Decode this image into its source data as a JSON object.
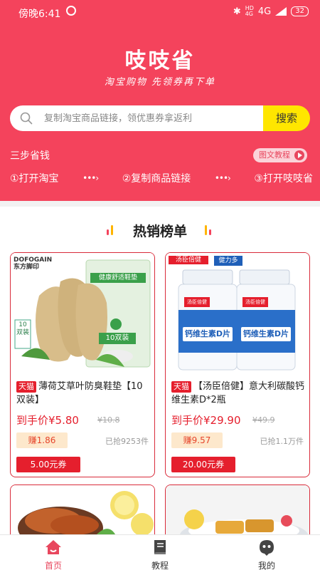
{
  "status_bar": {
    "time": "傍晚6:41",
    "network_top": "HD",
    "network_bottom": "4G",
    "network": "4G",
    "battery": "32"
  },
  "brand": {
    "title": "吱吱省",
    "subtitle": "淘宝购物 先领券再下单"
  },
  "search": {
    "placeholder": "复制淘宝商品链接，领优惠券拿返利",
    "button": "搜索"
  },
  "steps": {
    "title": "三步省钱",
    "tutorial": "图文教程",
    "items": [
      "①打开淘宝",
      "②复制商品链接",
      "③打开吱吱省"
    ],
    "arrow": "•••›"
  },
  "hot_list": {
    "title": "热销榜单",
    "products": [
      {
        "platform": "天猫",
        "name": "薄荷艾草叶防臭鞋垫【10双装】",
        "price": "到手价¥5.80",
        "old_price": "¥10.8",
        "earn": "赚1.86",
        "sold": "已抢9253件",
        "coupon": "5.00元券",
        "brand_text": "DOFOGAIN 东方脚印",
        "package_label": "健康舒适鞋垫",
        "badge": "10双装"
      },
      {
        "platform": "天猫",
        "name": "【汤臣倍健】意大利碳酸钙维生素D*2瓶",
        "price": "到手价¥29.90",
        "old_price": "¥49.9",
        "earn": "赚9.57",
        "sold": "已抢1.1万件",
        "coupon": "20.00元券",
        "brand_text": "汤臣倍健",
        "brand_text2": "健力多",
        "bottle_label": "钙维生素D片"
      }
    ]
  },
  "tabbar": [
    {
      "label": "首页",
      "icon": "home-icon",
      "active": true
    },
    {
      "label": "教程",
      "icon": "book-icon",
      "active": false
    },
    {
      "label": "我的",
      "icon": "profile-icon",
      "active": false
    }
  ],
  "colors": {
    "primary": "#f4435c",
    "accent": "#ffe600",
    "price": "#e51f2d"
  }
}
